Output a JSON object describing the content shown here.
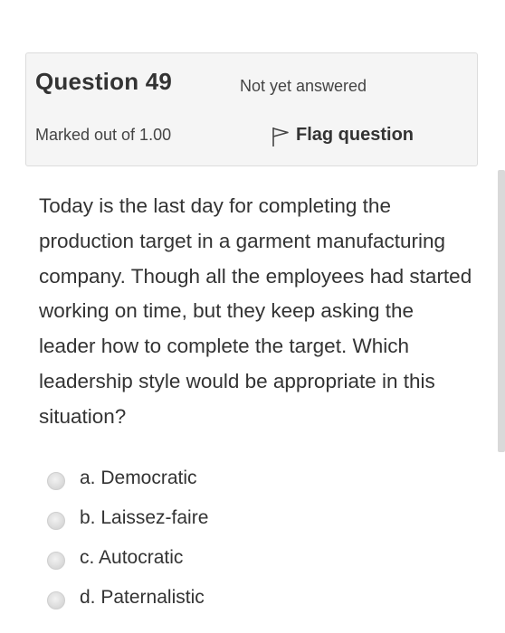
{
  "question": {
    "title_prefix": "Question ",
    "number": "49",
    "state": "Not yet answered",
    "grade": "Marked out of 1.00",
    "flag_label": "Flag question",
    "flag_icon": "flag-outline-icon",
    "text": "Today is the last day for completing the production target in a garment manufacturing company. Though all the employees had started working on time, but they keep asking the leader how to complete the target. Which leadership style would be appropriate in this situation?"
  },
  "answers": [
    {
      "label": "a. Democratic"
    },
    {
      "label": "b. Laissez-faire"
    },
    {
      "label": "c. Autocratic"
    },
    {
      "label": "d. Paternalistic"
    }
  ],
  "colors": {
    "info_background": "#f5f5f5",
    "info_border": "#dcdcdc",
    "text": "#333333",
    "scrollbar": "#d9d9d9"
  }
}
